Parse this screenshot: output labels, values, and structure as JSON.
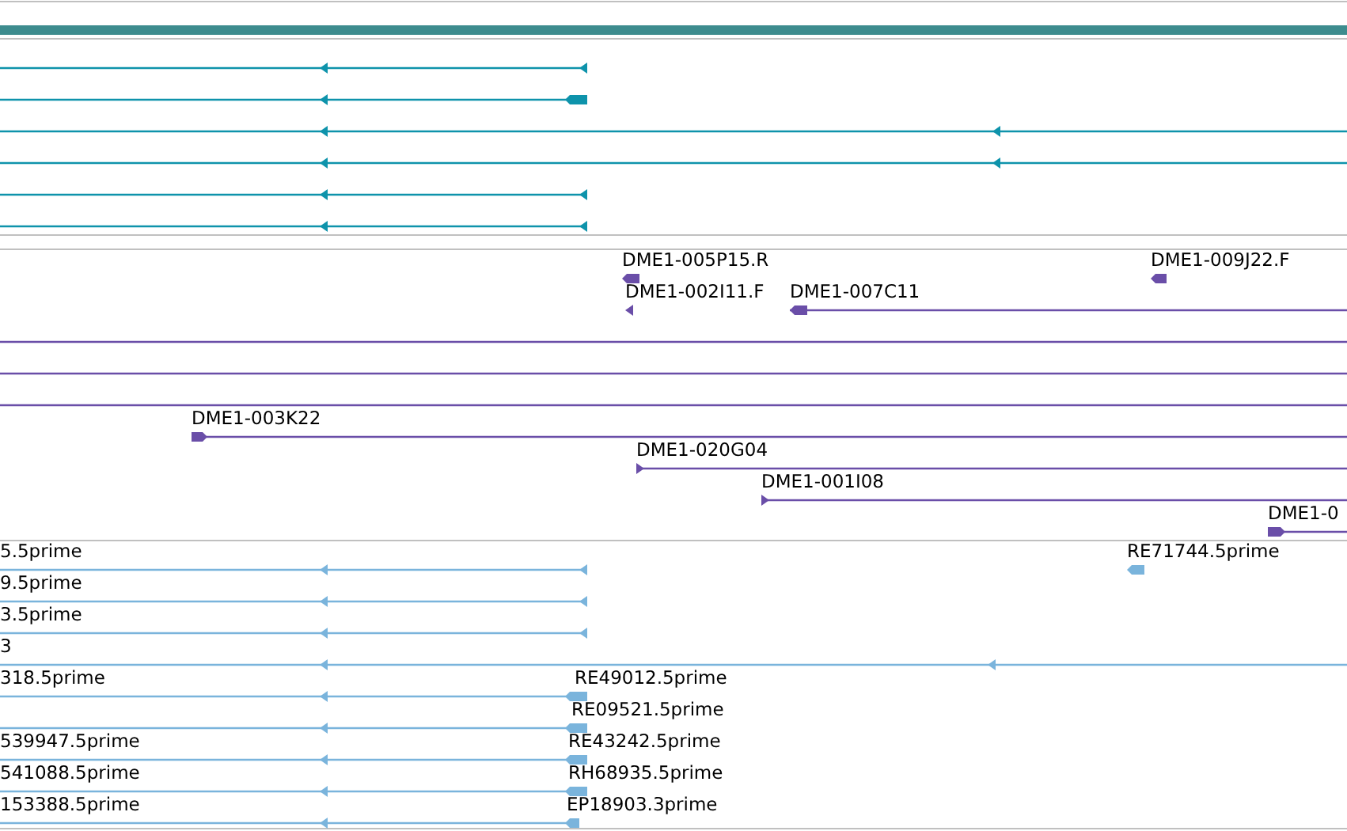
{
  "tracks": [
    {
      "color": "#0e93ab"
    },
    {
      "color": "#6a4ea8",
      "labels": [
        "DME1-005P15.R",
        "DME1-009J22.F",
        "DME1-002I11.F",
        "DME1-007C11",
        "DME1-003K22",
        "DME1-020G04",
        "DME1-001I08",
        "DME1-0"
      ]
    },
    {
      "color": "#7ab4dc",
      "labels": [
        "5.5prime",
        "RE71744.5prime",
        "9.5prime",
        "3.5prime",
        "3",
        "318.5prime",
        "RE49012.5prime",
        "RE09521.5prime",
        "539947.5prime",
        "RE43242.5prime",
        "541088.5prime",
        "RH68935.5prime",
        "153388.5prime",
        "EP18903.3prime"
      ]
    }
  ]
}
